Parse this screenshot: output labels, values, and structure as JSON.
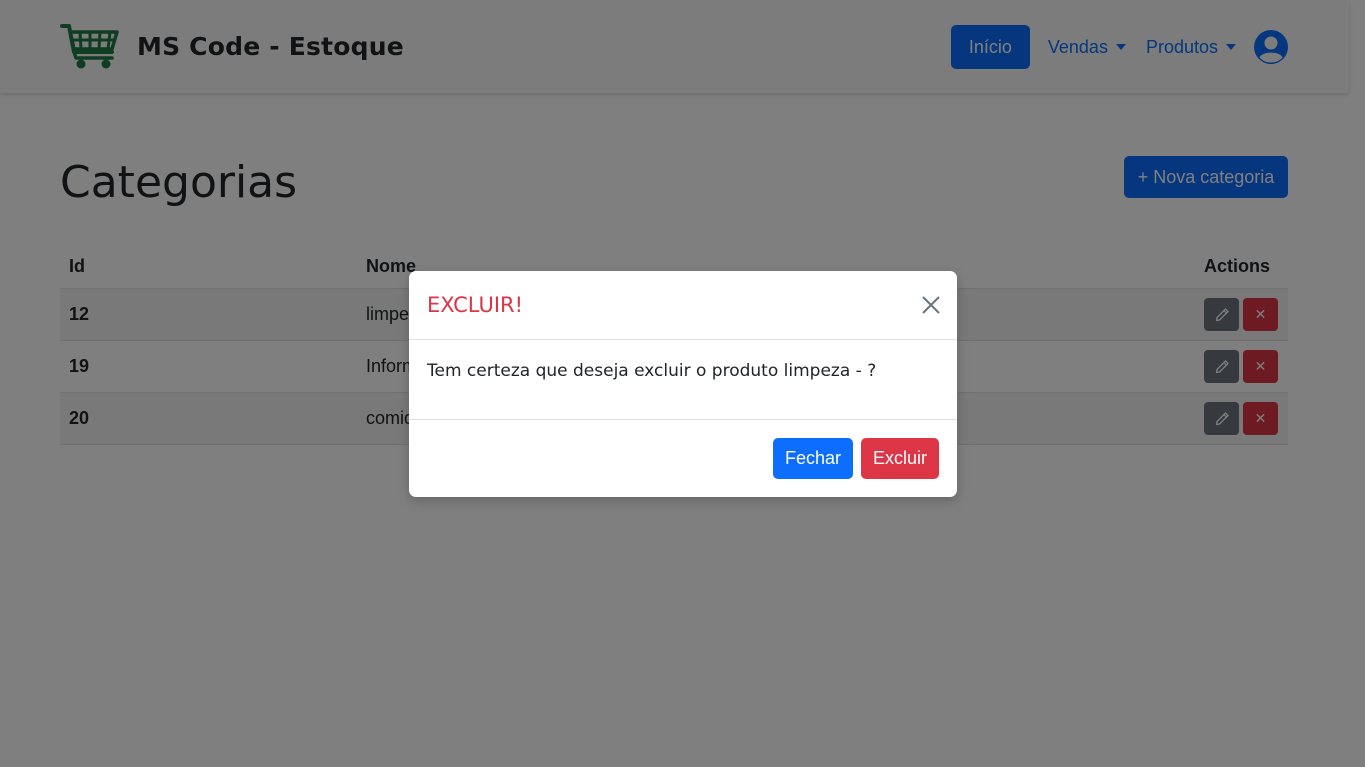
{
  "brand": {
    "name": "MS Code - Estoque",
    "icon": "shopping-cart-icon",
    "icon_color": "#1e7a43"
  },
  "nav": {
    "home_label": "Início",
    "sales_label": "Vendas",
    "products_label": "Produtos",
    "user_icon": "user-circle-icon"
  },
  "page": {
    "title": "Categorias",
    "new_button_label": "+ Nova categoria"
  },
  "table": {
    "headers": {
      "id": "Id",
      "name": "Nome",
      "actions": "Actions"
    },
    "rows": [
      {
        "id": "12",
        "name": "limpeza"
      },
      {
        "id": "19",
        "name": "Informática"
      },
      {
        "id": "20",
        "name": "comida"
      }
    ]
  },
  "modal": {
    "title": "EXCLUIR!",
    "message": "Tem certeza que deseja excluir o produto limpeza - ?",
    "close_label": "Fechar",
    "delete_label": "Excluir"
  },
  "colors": {
    "primary": "#0d6efd",
    "danger": "#dc3545",
    "secondary": "#6c757d",
    "navbar_bg": "#f8f9fa"
  }
}
